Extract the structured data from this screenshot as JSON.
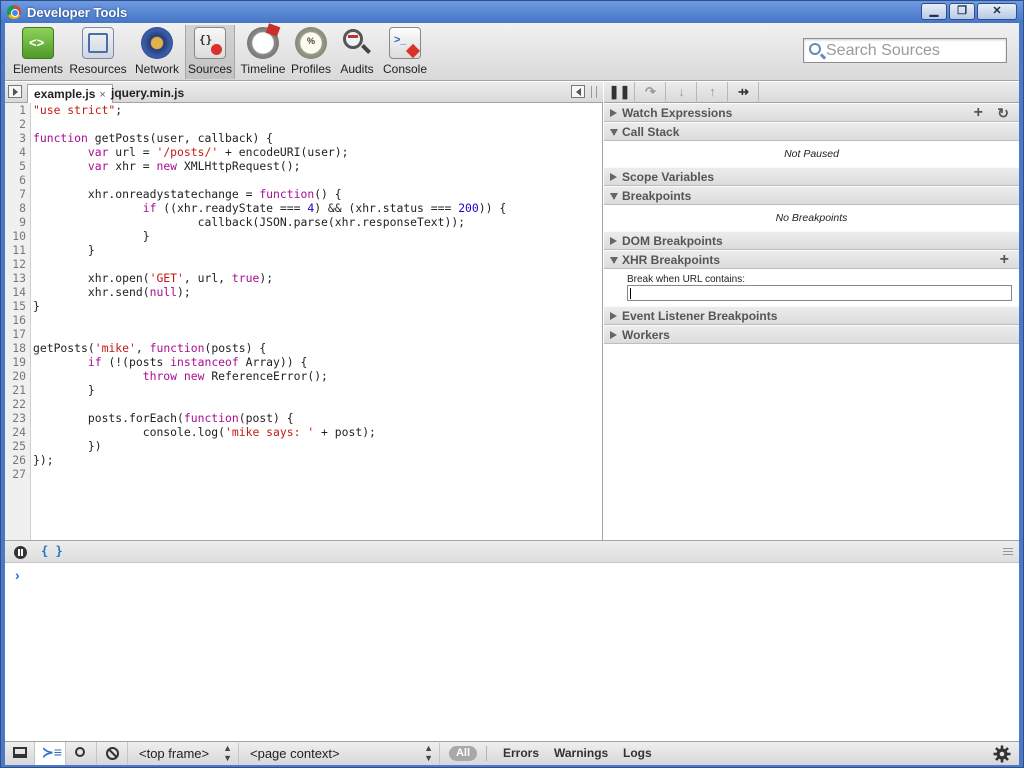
{
  "window": {
    "title": "Developer Tools",
    "controls": {
      "minimize": "▁",
      "maximize": "❐",
      "close": "✕"
    }
  },
  "toolbar": {
    "items": [
      {
        "label": "Elements",
        "icon": "elements-icon"
      },
      {
        "label": "Resources",
        "icon": "resources-icon"
      },
      {
        "label": "Network",
        "icon": "network-icon"
      },
      {
        "label": "Sources",
        "icon": "sources-icon",
        "active": true
      },
      {
        "label": "Timeline",
        "icon": "timeline-icon"
      },
      {
        "label": "Profiles",
        "icon": "profiles-icon"
      },
      {
        "label": "Audits",
        "icon": "audits-icon"
      },
      {
        "label": "Console",
        "icon": "console-icon"
      }
    ],
    "search_placeholder": "Search Sources"
  },
  "editor": {
    "tabs": [
      {
        "label": "example.js",
        "active": true,
        "close": "×"
      },
      {
        "label": "jquery.min.js",
        "active": false
      }
    ],
    "code": [
      "\"use strict\";",
      "",
      "function getPosts(user, callback) {",
      "        var url = '/posts/' + encodeURI(user);",
      "        var xhr = new XMLHttpRequest();",
      "",
      "        xhr.onreadystatechange = function() {",
      "                if ((xhr.readyState === 4) && (xhr.status === 200)) {",
      "                        callback(JSON.parse(xhr.responseText));",
      "                }",
      "        }",
      "",
      "        xhr.open('GET', url, true);",
      "        xhr.send(null);",
      "}",
      "",
      "",
      "getPosts('mike', function(posts) {",
      "        if (!(posts instanceof Array)) {",
      "                throw new ReferenceError();",
      "        }",
      "",
      "        posts.forEach(function(post) {",
      "                console.log('mike says: ' + post);",
      "        })",
      "});",
      ""
    ]
  },
  "debugger": {
    "buttons": [
      "pause-icon",
      "step-over-icon",
      "step-into-icon",
      "step-out-icon",
      "deactivate-breakpoints-icon"
    ],
    "sections": [
      {
        "title": "Watch Expressions",
        "expanded": false,
        "plus": "+",
        "refresh": "↻"
      },
      {
        "title": "Call Stack",
        "expanded": true,
        "message": "Not Paused"
      },
      {
        "title": "Scope Variables",
        "expanded": false
      },
      {
        "title": "Breakpoints",
        "expanded": true,
        "message": "No Breakpoints"
      },
      {
        "title": "DOM Breakpoints",
        "expanded": false
      },
      {
        "title": "XHR Breakpoints",
        "expanded": true,
        "plus": "+",
        "field_label": "Break when URL contains:",
        "field_value": ""
      },
      {
        "title": "Event Listener Breakpoints",
        "expanded": false
      },
      {
        "title": "Workers",
        "expanded": false
      }
    ]
  },
  "console": {
    "pretty_print": "{ }",
    "prompt": "›"
  },
  "statusbar": {
    "frame_select": "<top frame>",
    "context_select": "<page context>",
    "filter_all": "All",
    "filters": [
      "Errors",
      "Warnings",
      "Logs"
    ]
  },
  "colors": {
    "keyword": "#aa0d91",
    "string": "#c41a16",
    "number": "#1c00cf",
    "link_blue": "#2a6fc8"
  }
}
